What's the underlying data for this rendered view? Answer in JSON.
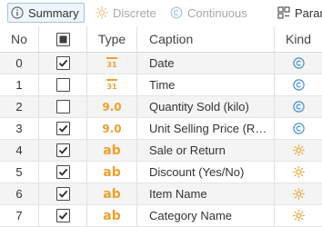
{
  "toolbar": {
    "summary_label": "Summary",
    "discrete_label": "Discrete",
    "continuous_label": "Continuous",
    "param_label": "Param"
  },
  "table": {
    "headers": {
      "no": "No",
      "type": "Type",
      "caption": "Caption",
      "kind": "Kind"
    },
    "header_checkbox_state": "indeterminate",
    "rows": [
      {
        "no": "0",
        "checked": true,
        "type": "date",
        "type_text": "31",
        "caption": "Date",
        "kind": "continuous"
      },
      {
        "no": "1",
        "checked": false,
        "type": "date",
        "type_text": "31",
        "caption": "Time",
        "kind": "continuous"
      },
      {
        "no": "2",
        "checked": false,
        "type": "numeric",
        "type_text": "9.0",
        "caption": "Quantity Sold (kilo)",
        "kind": "continuous"
      },
      {
        "no": "3",
        "checked": true,
        "type": "numeric",
        "type_text": "9.0",
        "caption": "Unit Selling Price (R…",
        "kind": "continuous"
      },
      {
        "no": "4",
        "checked": true,
        "type": "text",
        "type_text": "ab",
        "caption": "Sale or Return",
        "kind": "discrete"
      },
      {
        "no": "5",
        "checked": true,
        "type": "text",
        "type_text": "ab",
        "caption": "Discount (Yes/No)",
        "kind": "discrete"
      },
      {
        "no": "6",
        "checked": true,
        "type": "text",
        "type_text": "ab",
        "caption": "Item Name",
        "kind": "discrete"
      },
      {
        "no": "7",
        "checked": true,
        "type": "text",
        "type_text": "ab",
        "caption": "Category Name",
        "kind": "discrete"
      }
    ]
  },
  "colors": {
    "accent_orange": "#f0a030",
    "continuous_blue": "#4a90d9",
    "discrete_orange": "#f0a030",
    "selected_border": "#9fc4e8"
  },
  "icons": {
    "summary": "info-circle-icon",
    "discrete": "sun-icon",
    "continuous": "c-circle-icon",
    "param": "grid-params-icon"
  }
}
